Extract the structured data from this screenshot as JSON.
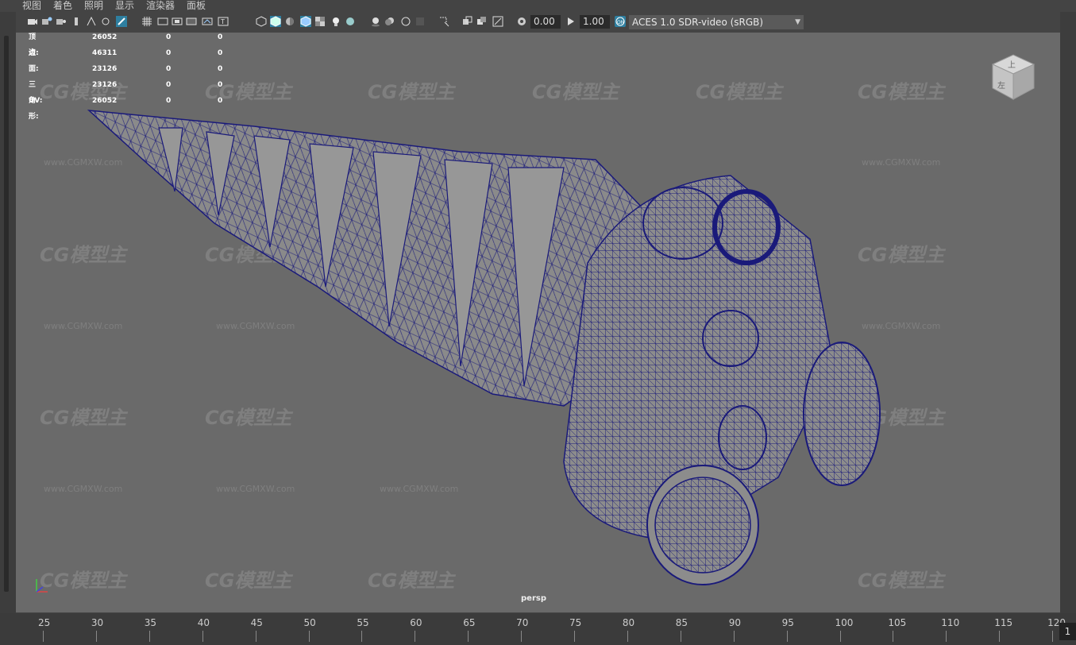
{
  "menu": {
    "items": [
      "视图",
      "着色",
      "照明",
      "显示",
      "渲染器",
      "面板"
    ]
  },
  "toolbar": {
    "exposure": "0.00",
    "gamma": "1.00",
    "color_management": "ACES 1.0 SDR-video (sRGB)"
  },
  "hud": {
    "rows": [
      {
        "label": "顶点:",
        "v1": "26052",
        "v2": "0",
        "v3": "0"
      },
      {
        "label": "边:",
        "v1": "46311",
        "v2": "0",
        "v3": "0"
      },
      {
        "label": "面:",
        "v1": "23126",
        "v2": "0",
        "v3": "0"
      },
      {
        "label": "三角形:",
        "v1": "23126",
        "v2": "0",
        "v3": "0"
      },
      {
        "label": "UV:",
        "v1": "26052",
        "v2": "0",
        "v3": "0"
      }
    ]
  },
  "viewport": {
    "camera": "persp"
  },
  "viewcube": {
    "top_label": "上",
    "left_label": "左"
  },
  "watermark": {
    "logo": "CG模型主",
    "url": "www.CGMXW.com"
  },
  "timeline": {
    "ticks": [
      "25",
      "30",
      "35",
      "40",
      "45",
      "50",
      "55",
      "60",
      "65",
      "70",
      "75",
      "80",
      "85",
      "90",
      "95",
      "100",
      "105",
      "110",
      "115",
      "120"
    ],
    "current_frame": "1"
  },
  "colors": {
    "wireframe": "#1a1a7a",
    "viewport_bg": "#6a6a6a",
    "model_fill": "#8a8a8a"
  }
}
